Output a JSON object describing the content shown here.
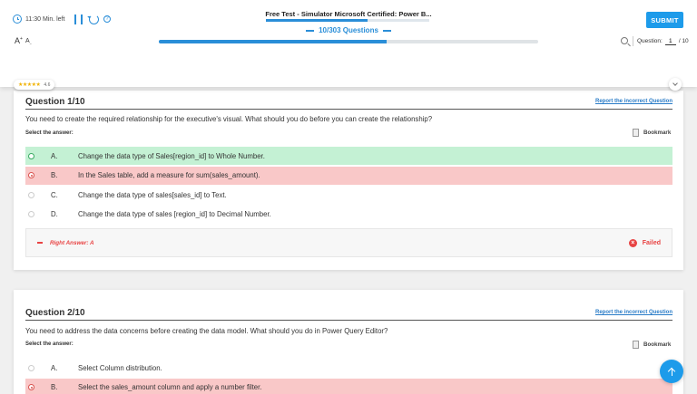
{
  "header": {
    "time_left": "11:30 Min. left",
    "test_title": "Free Test - Simulator Microsoft Certified: Power B...",
    "submit_label": "SUBMIT",
    "question_counter": "10/303 Questions",
    "progress_fraction": 0.6,
    "font_increase": "A",
    "font_decrease": "A",
    "question_label": "Question:",
    "current_question": "1",
    "total_questions": "/ 10",
    "rating_stars": "★★★★★",
    "rating_value": "4.6"
  },
  "report_label": "Report the incorrect Question",
  "select_label": "Select the answer:",
  "bookmark_label": "Bookmark",
  "questions": [
    {
      "title": "Question 1/10",
      "text": "You need to create the required relationship for the executive's visual. What should you do before you can create the relationship?",
      "options": [
        {
          "letter": "A.",
          "text": "Change the data type of Sales[region_id] to Whole Number.",
          "state": "correct"
        },
        {
          "letter": "B.",
          "text": "In the Sales table, add a measure for sum(sales_amount).",
          "state": "wrong"
        },
        {
          "letter": "C.",
          "text": "Change the data type of sales[sales_id] to Text.",
          "state": "none"
        },
        {
          "letter": "D.",
          "text": "Change the data type of sales [region_id] to Decimal Number.",
          "state": "none"
        }
      ],
      "right_answer": "Right Answer: A",
      "result": "Failed"
    },
    {
      "title": "Question 2/10",
      "text": "You need to address the data concerns before creating the data model. What should you do in Power Query Editor?",
      "options": [
        {
          "letter": "A.",
          "text": "Select Column distribution.",
          "state": "none"
        },
        {
          "letter": "B.",
          "text": "Select the sales_amount column and apply a number filter.",
          "state": "wrong"
        }
      ]
    }
  ],
  "colors": {
    "accent": "#1d9bea",
    "correct_bg": "#c4f1d4",
    "wrong_bg": "#f9c8c8",
    "failed": "#e84343"
  }
}
